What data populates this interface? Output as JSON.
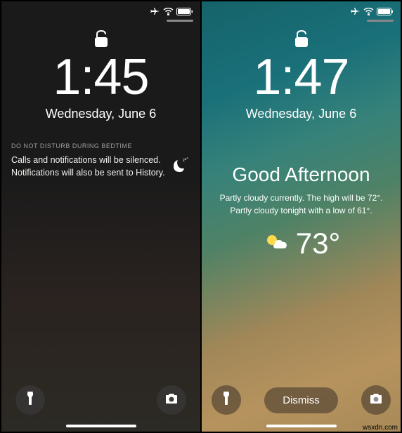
{
  "left": {
    "time": "1:45",
    "date": "Wednesday, June 6",
    "dnd_title": "DO NOT DISTURB DURING BEDTIME",
    "dnd_text": "Calls and notifications will be silenced. Notifications will also be sent to History."
  },
  "right": {
    "time": "1:47",
    "date": "Wednesday, June 6",
    "greeting_title": "Good Afternoon",
    "greeting_text": "Partly cloudy currently. The high will be 72°. Partly cloudy tonight with a low of 61°.",
    "temperature": "73°",
    "dismiss_label": "Dismiss"
  },
  "watermark": "wsxdn.com"
}
